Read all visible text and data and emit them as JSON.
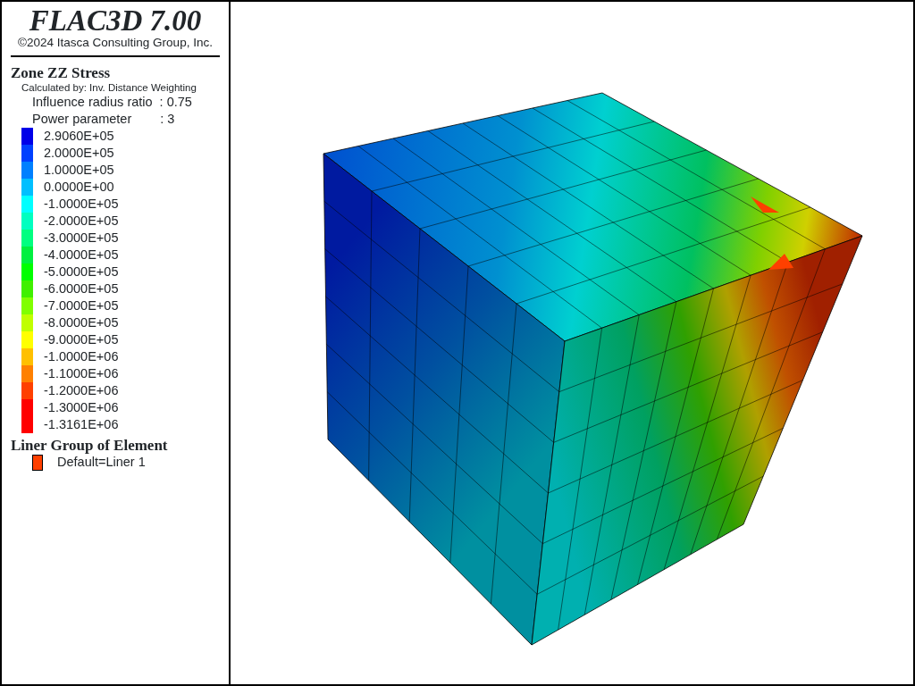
{
  "title": "FLAC3D 7.00",
  "copyright": "©2024 Itasca Consulting Group, Inc.",
  "contour_legend": {
    "title": "Zone ZZ Stress",
    "method": "Calculated by: Inv. Distance Weighting",
    "parameters": [
      {
        "label": "Influence radius ratio",
        "value": ": 0.75"
      },
      {
        "label": "Power parameter",
        "value": ": 3"
      }
    ],
    "entries": [
      {
        "label": "2.9060E+05",
        "color": "#0000e8"
      },
      {
        "label": "2.0000E+05",
        "color": "#0040ff"
      },
      {
        "label": "1.0000E+05",
        "color": "#0080ff"
      },
      {
        "label": "0.0000E+00",
        "color": "#00bfff"
      },
      {
        "label": "-1.0000E+05",
        "color": "#00ffff"
      },
      {
        "label": "-2.0000E+05",
        "color": "#00ffc0"
      },
      {
        "label": "-3.0000E+05",
        "color": "#00ff80"
      },
      {
        "label": "-4.0000E+05",
        "color": "#00f040"
      },
      {
        "label": "-5.0000E+05",
        "color": "#00ff00"
      },
      {
        "label": "-6.0000E+05",
        "color": "#40f000"
      },
      {
        "label": "-7.0000E+05",
        "color": "#80ff00"
      },
      {
        "label": "-8.0000E+05",
        "color": "#c0ff00"
      },
      {
        "label": "-9.0000E+05",
        "color": "#ffff00"
      },
      {
        "label": "-1.0000E+06",
        "color": "#ffc000"
      },
      {
        "label": "-1.1000E+06",
        "color": "#ff8000"
      },
      {
        "label": "-1.2000E+06",
        "color": "#ff4000"
      },
      {
        "label": "-1.3000E+06",
        "color": "#ff0000"
      },
      {
        "label": "-1.3161E+06",
        "color": "#ff0000"
      }
    ]
  },
  "liner_legend": {
    "title": "Liner Group of Element",
    "entries": [
      {
        "label": "Default=Liner 1",
        "color": "#ff4000"
      }
    ]
  }
}
